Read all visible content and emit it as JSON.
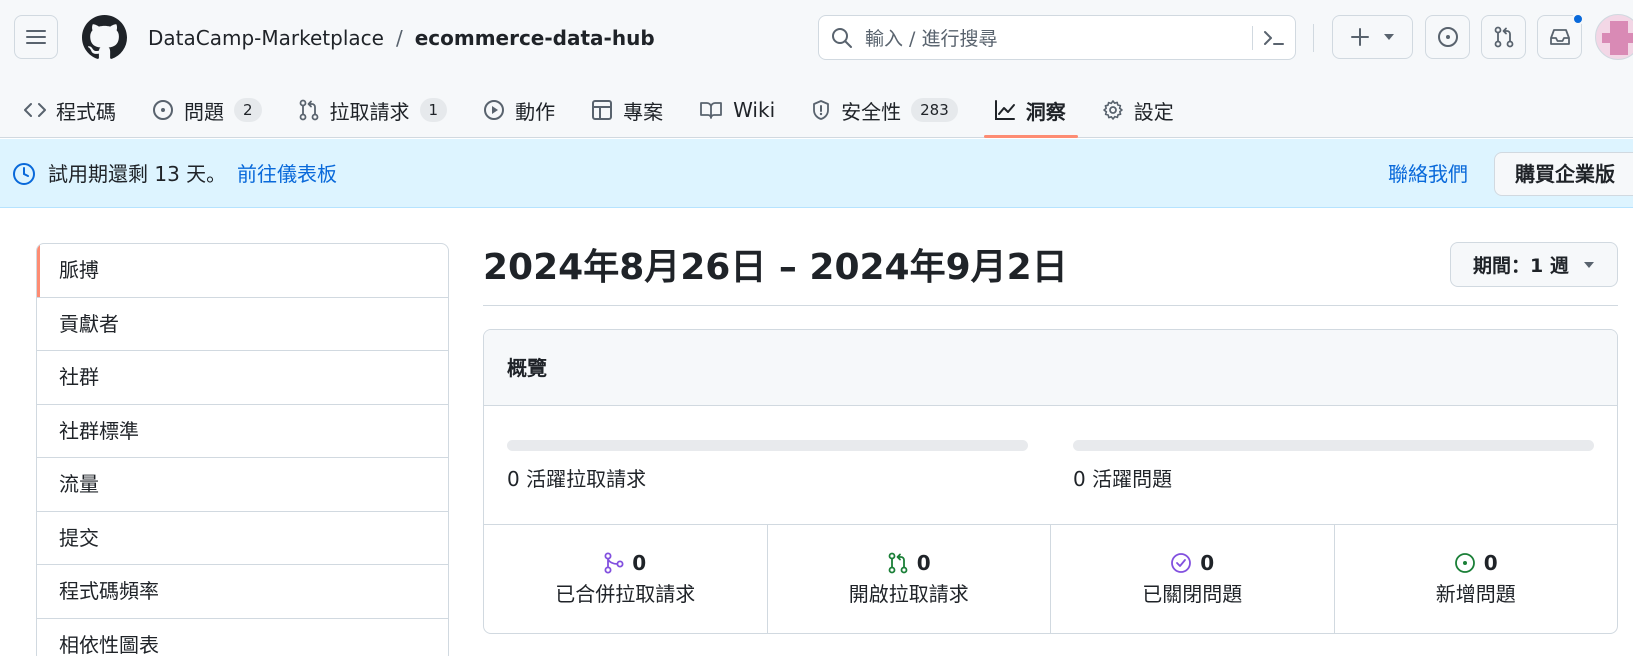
{
  "header": {
    "owner": "DataCamp-Marketplace",
    "separator": "/",
    "repo": "ecommerce-data-hub",
    "search_placeholder": "輸入 / 進行搜尋",
    "icons": [
      "menu-icon",
      "github-logo",
      "search-icon",
      "command-palette-icon",
      "plus-icon",
      "caret-down-icon",
      "issue-opened-icon",
      "git-pull-request-icon",
      "inbox-icon"
    ]
  },
  "tabs": [
    {
      "label": "程式碼",
      "icon": "code-icon"
    },
    {
      "label": "問題",
      "count": "2",
      "icon": "issue-opened-icon"
    },
    {
      "label": "拉取請求",
      "count": "1",
      "icon": "git-pull-request-icon"
    },
    {
      "label": "動作",
      "icon": "play-icon"
    },
    {
      "label": "專案",
      "icon": "table-icon"
    },
    {
      "label": "Wiki",
      "icon": "book-icon"
    },
    {
      "label": "安全性",
      "count": "283",
      "icon": "shield-icon"
    },
    {
      "label": "洞察",
      "icon": "graph-icon",
      "active": true
    },
    {
      "label": "設定",
      "icon": "gear-icon"
    }
  ],
  "banner": {
    "message": "試用期還剩 13 天。",
    "dashboard_link": "前往儀表板",
    "contact": "聯絡我們",
    "buy": "購買企業版"
  },
  "sidebar": {
    "items": [
      "脈搏",
      "貢獻者",
      "社群",
      "社群標準",
      "流量",
      "提交",
      "程式碼頻率",
      "相依性圖表"
    ],
    "active_index": 0
  },
  "main": {
    "date_range": "2024年8月26日 – 2024年9月2日",
    "period_label": "期間：1 週",
    "overview": {
      "title": "概覽",
      "active_prs": "0 活躍拉取請求",
      "active_issues": "0 活躍問題",
      "stats": [
        {
          "value": "0",
          "label": "已合併拉取請求",
          "icon": "git-merge-icon",
          "color": "#8250df"
        },
        {
          "value": "0",
          "label": "開啟拉取請求",
          "icon": "git-pull-request-icon",
          "color": "#1a7f37"
        },
        {
          "value": "0",
          "label": "已關閉問題",
          "icon": "issue-closed-icon",
          "color": "#8250df"
        },
        {
          "value": "0",
          "label": "新增問題",
          "icon": "issue-opened-icon",
          "color": "#1a7f37"
        }
      ]
    }
  },
  "colors": {
    "accent_underline": "#fd8c73",
    "link": "#0969da",
    "banner_bg": "#ddf4ff"
  }
}
